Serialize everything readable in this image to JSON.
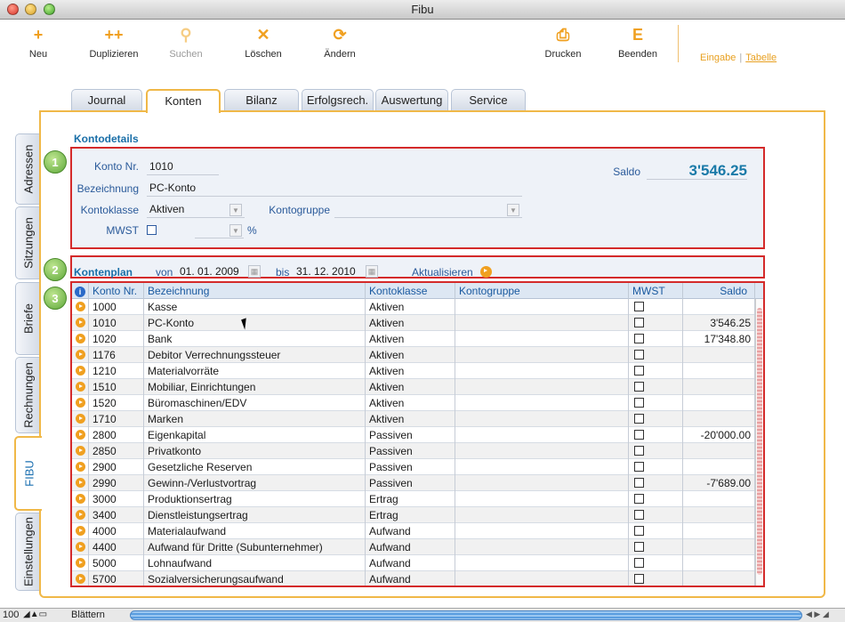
{
  "window": {
    "title": "Fibu"
  },
  "toolbar": {
    "buttons": [
      {
        "label": "Neu",
        "icon": "plus-icon",
        "glyph": "+",
        "enabled": true
      },
      {
        "label": "Duplizieren",
        "icon": "double-plus-icon",
        "glyph": "++",
        "enabled": true
      },
      {
        "label": "Suchen",
        "icon": "search-icon",
        "glyph": "⚲",
        "enabled": false
      },
      {
        "label": "Löschen",
        "icon": "cross-icon",
        "glyph": "✕",
        "enabled": true
      },
      {
        "label": "Ändern",
        "icon": "refresh-icon",
        "glyph": "⟳",
        "enabled": true
      },
      {
        "label": "Drucken",
        "icon": "printer-icon",
        "glyph": "⎙",
        "enabled": true
      },
      {
        "label": "Beenden",
        "icon": "exit-icon",
        "glyph": "E",
        "enabled": true
      }
    ],
    "view_switch": {
      "eingabe": "Eingabe",
      "separator": "|",
      "tabelle": "Tabelle"
    }
  },
  "tabs": [
    "Journal",
    "Konten",
    "Bilanz",
    "Erfolgsrech.",
    "Auswertung",
    "Service"
  ],
  "active_tab": "Konten",
  "side_tabs": [
    "Adressen",
    "Sitzungen",
    "Briefe",
    "Rechnungen",
    "FIBU",
    "Einstellungen"
  ],
  "active_side_tab": "FIBU",
  "kontodetails": {
    "title": "Kontodetails",
    "badge": "1",
    "konto_nr_label": "Konto Nr.",
    "konto_nr": "1010",
    "bezeichnung_label": "Bezeichnung",
    "bezeichnung": "PC-Konto",
    "kontoklasse_label": "Kontoklasse",
    "kontoklasse": "Aktiven",
    "kontogruppe_label": "Kontogruppe",
    "kontogruppe": "",
    "mwst_label": "MWST",
    "mwst_percent": "%",
    "saldo_label": "Saldo",
    "saldo": "3'546.25"
  },
  "kontenplan": {
    "title": "Kontenplan",
    "badge": "2",
    "von_label": "von",
    "von": "01. 01. 2009",
    "bis_label": "bis",
    "bis": "31. 12. 2010",
    "refresh_label": "Aktualisieren"
  },
  "table": {
    "badge": "3",
    "columns": [
      "Konto Nr.",
      "Bezeichnung",
      "Kontoklasse",
      "Kontogruppe",
      "MWST",
      "Saldo"
    ],
    "rows": [
      {
        "nr": "1000",
        "bez": "Kasse",
        "klasse": "Aktiven",
        "gruppe": "",
        "saldo": ""
      },
      {
        "nr": "1010",
        "bez": "PC-Konto",
        "klasse": "Aktiven",
        "gruppe": "",
        "saldo": "3'546.25"
      },
      {
        "nr": "1020",
        "bez": "Bank",
        "klasse": "Aktiven",
        "gruppe": "",
        "saldo": "17'348.80"
      },
      {
        "nr": "1176",
        "bez": "Debitor Verrechnungssteuer",
        "klasse": "Aktiven",
        "gruppe": "",
        "saldo": ""
      },
      {
        "nr": "1210",
        "bez": "Materialvorräte",
        "klasse": "Aktiven",
        "gruppe": "",
        "saldo": ""
      },
      {
        "nr": "1510",
        "bez": "Mobiliar, Einrichtungen",
        "klasse": "Aktiven",
        "gruppe": "",
        "saldo": ""
      },
      {
        "nr": "1520",
        "bez": "Büromaschinen/EDV",
        "klasse": "Aktiven",
        "gruppe": "",
        "saldo": ""
      },
      {
        "nr": "1710",
        "bez": "Marken",
        "klasse": "Aktiven",
        "gruppe": "",
        "saldo": ""
      },
      {
        "nr": "2800",
        "bez": "Eigenkapital",
        "klasse": "Passiven",
        "gruppe": "",
        "saldo": "-20'000.00"
      },
      {
        "nr": "2850",
        "bez": "Privatkonto",
        "klasse": "Passiven",
        "gruppe": "",
        "saldo": ""
      },
      {
        "nr": "2900",
        "bez": "Gesetzliche Reserven",
        "klasse": "Passiven",
        "gruppe": "",
        "saldo": ""
      },
      {
        "nr": "2990",
        "bez": "Gewinn-/Verlustvortrag",
        "klasse": "Passiven",
        "gruppe": "",
        "saldo": "-7'689.00"
      },
      {
        "nr": "3000",
        "bez": "Produktionsertrag",
        "klasse": "Ertrag",
        "gruppe": "",
        "saldo": ""
      },
      {
        "nr": "3400",
        "bez": "Dienstleistungsertrag",
        "klasse": "Ertrag",
        "gruppe": "",
        "saldo": ""
      },
      {
        "nr": "4000",
        "bez": "Materialaufwand",
        "klasse": "Aufwand",
        "gruppe": "",
        "saldo": ""
      },
      {
        "nr": "4400",
        "bez": "Aufwand für Dritte (Subunternehmer)",
        "klasse": "Aufwand",
        "gruppe": "",
        "saldo": ""
      },
      {
        "nr": "5000",
        "bez": "Lohnaufwand",
        "klasse": "Aufwand",
        "gruppe": "",
        "saldo": ""
      },
      {
        "nr": "5700",
        "bez": "Sozialversicherungsaufwand",
        "klasse": "Aufwand",
        "gruppe": "",
        "saldo": ""
      }
    ]
  },
  "statusbar": {
    "zoom": "100",
    "mode": "Blättern"
  },
  "colors": {
    "accent": "#f0a020",
    "frame": "#f0b848",
    "highlight_box": "#d42a2a",
    "label_blue": "#1a6fa8"
  }
}
